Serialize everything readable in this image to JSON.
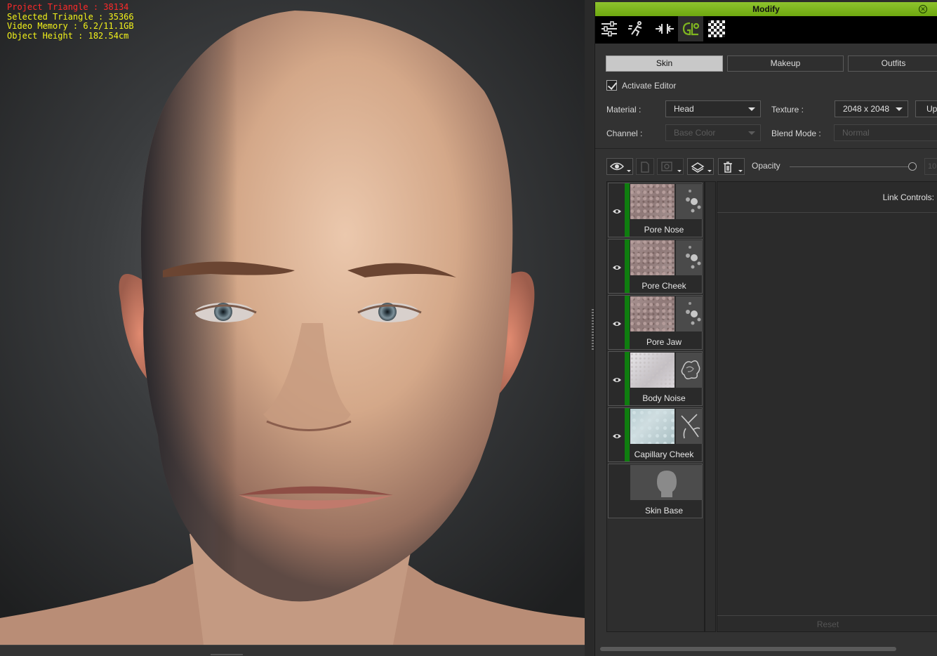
{
  "viewport": {
    "stats": {
      "project_triangle": "Project Triangle : 38134",
      "selected_triangle": "Selected Triangle : 35366",
      "video_memory": "Video Memory : 6.2/11.1GB",
      "object_height": "Object Height : 182.54cm"
    },
    "image": "3d-bald-male-head-render"
  },
  "panel": {
    "title": "Modify",
    "toolbar": [
      {
        "icon": "sliders-icon",
        "active": false
      },
      {
        "icon": "motion-icon",
        "active": false
      },
      {
        "icon": "morph-icon",
        "active": false
      },
      {
        "icon": "skin-editor-icon",
        "active": true
      },
      {
        "icon": "checker-texture-icon",
        "active": false
      }
    ],
    "tabs": {
      "skin": "Skin",
      "makeup": "Makeup",
      "outfits": "Outfits",
      "active": "Skin"
    },
    "activate_editor": {
      "label": "Activate Editor",
      "checked": true
    },
    "material": {
      "label": "Material :",
      "value": "Head"
    },
    "texture": {
      "label": "Texture :",
      "value": "2048 x 2048",
      "update_label": "Up"
    },
    "channel": {
      "label": "Channel :",
      "value": "Base Color"
    },
    "blend_mode": {
      "label": "Blend Mode :",
      "value": "Normal"
    },
    "opacity": {
      "label": "Opacity",
      "value": "10"
    },
    "layers": [
      {
        "name": "Pore Nose",
        "texture": "pore",
        "visible": true
      },
      {
        "name": "Pore Cheek",
        "texture": "pore",
        "visible": true
      },
      {
        "name": "Pore Jaw",
        "texture": "pore",
        "visible": true
      },
      {
        "name": "Body Noise",
        "texture": "noise",
        "visible": true
      },
      {
        "name": "Capillary Cheek",
        "texture": "capillary",
        "visible": true
      },
      {
        "name": "Skin Base",
        "texture": "skin-base",
        "visible": false
      }
    ],
    "link_controls": "Link Controls:",
    "reset": "Reset",
    "accent": "#7fb520"
  }
}
